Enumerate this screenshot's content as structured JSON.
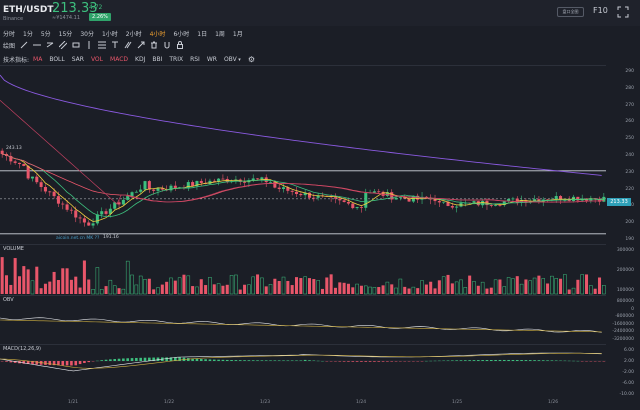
{
  "header": {
    "pair": "ETH/USDT",
    "exchange": "Binance",
    "price": "213.33",
    "change_abs": "4.72",
    "price_cny": "≈¥1474.11",
    "change_pct": "2.26%",
    "button_label": "盘口全图",
    "f10_label": "F10"
  },
  "timeframes": [
    "分时",
    "1分",
    "5分",
    "15分",
    "30分",
    "1小时",
    "2小时",
    "4小时",
    "6小时",
    "1日",
    "1周",
    "1月"
  ],
  "active_timeframe": "4小时",
  "drawing_label": "绘图",
  "indicators": {
    "label": "技术指标:",
    "items": [
      {
        "name": "MA",
        "on": true,
        "dropdown": false
      },
      {
        "name": "BOLL",
        "on": false,
        "dropdown": false
      },
      {
        "name": "SAR",
        "on": false,
        "dropdown": false
      },
      {
        "name": "VOL",
        "on": true,
        "dropdown": false
      },
      {
        "name": "MACD",
        "on": true,
        "dropdown": false
      },
      {
        "name": "KDJ",
        "on": false,
        "dropdown": false
      },
      {
        "name": "BBI",
        "on": false,
        "dropdown": false
      },
      {
        "name": "TRIX",
        "on": false,
        "dropdown": false
      },
      {
        "name": "RSI",
        "on": false,
        "dropdown": false
      },
      {
        "name": "WR",
        "on": false,
        "dropdown": false
      },
      {
        "name": "OBV",
        "on": false,
        "dropdown": true
      }
    ]
  },
  "main_axis": [
    "290",
    "280",
    "270",
    "260",
    "250",
    "240",
    "230",
    "220",
    "210",
    "200",
    "190"
  ],
  "current_price_tag": "213.33",
  "annotations": {
    "high": "243.13",
    "low": "191.16",
    "watermark": "aicoin.net.cn  MK ??"
  },
  "volume": {
    "label": "VOLUME",
    "axis": [
      "300000",
      "200000",
      "100000"
    ]
  },
  "obv": {
    "label": "OBV",
    "axis": [
      "800000",
      "0",
      "-800000",
      "-1600000",
      "-2400000",
      "-3200000"
    ]
  },
  "macd": {
    "label": "MACD(12,26,9)",
    "axis": [
      "6.00",
      "2.00",
      "-2.00",
      "-6.00",
      "-10.00"
    ]
  },
  "x_labels": [
    "1/21",
    "1/22",
    "1/23",
    "1/24",
    "1/25",
    "1/26",
    "1/27"
  ],
  "colors": {
    "up": "#3dbf7e",
    "down": "#e8566a",
    "active": "#f0a030",
    "background": "#1b1e26"
  }
}
